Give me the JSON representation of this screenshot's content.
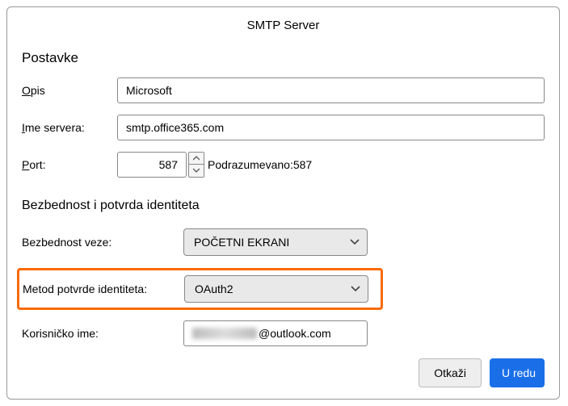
{
  "title": "SMTP Server",
  "settings_heading": "Postavke",
  "labels": {
    "description_pre": "O",
    "description_rest": "pis",
    "server_pre": "I",
    "server_rest": "me servera:",
    "port_pre": "P",
    "port_rest": "ort:",
    "default_port": "Podrazumevano:587",
    "conn_security": "Bezbednost veze:",
    "auth_method_pre": "Metod po",
    "auth_method_ul": "t",
    "auth_method_rest": "vrde identiteta:",
    "username_pre": "Korisnič",
    "username_ul": "k",
    "username_rest": "o ime:"
  },
  "security_heading": "Bezbednost i potvrda identiteta",
  "values": {
    "description": "Microsoft",
    "server": "smtp.office365.com",
    "port": "587",
    "conn_security": "POČETNI EKRANI",
    "auth_method": "OAuth2",
    "username_suffix": "@outlook.com"
  },
  "buttons": {
    "cancel": "Otkaži",
    "ok": "U redu"
  }
}
